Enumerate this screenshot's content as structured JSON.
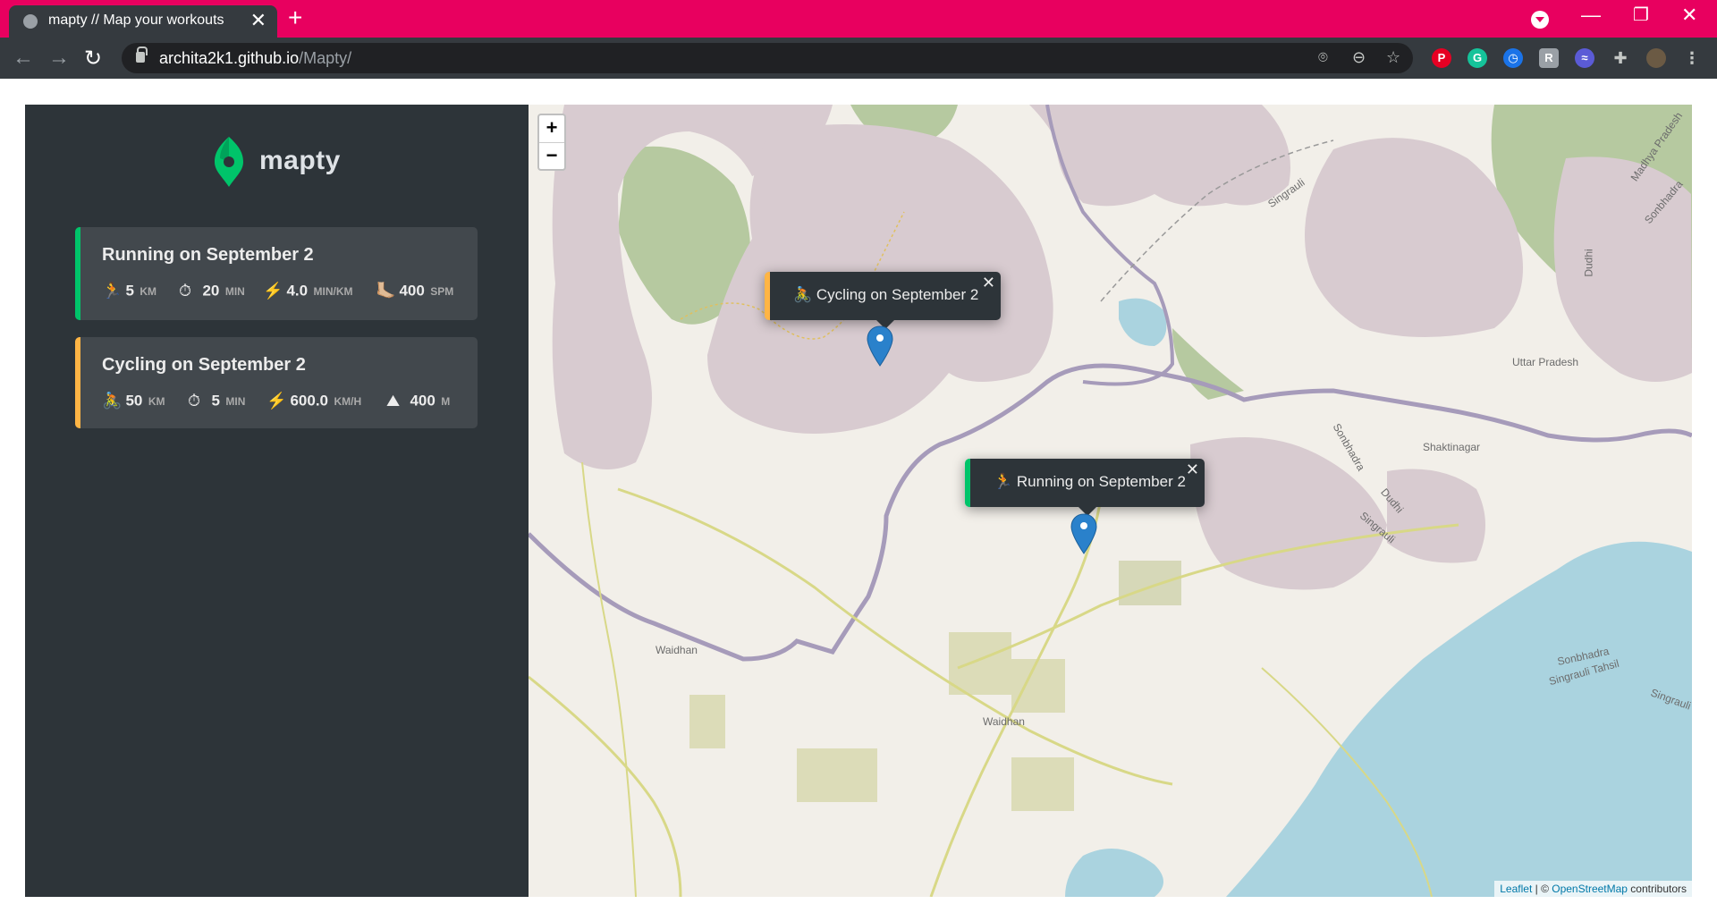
{
  "browser": {
    "tab_title": "mapty // Map your workouts",
    "tab_close": "✕",
    "new_tab": "+",
    "url_host": "archita2k1.github.io",
    "url_path": "/Mapty/",
    "back": "←",
    "forward": "→",
    "reload": "↻",
    "minimize": "—",
    "restore": "❐",
    "close": "✕",
    "extensions": [
      {
        "icon": "pinterest-icon",
        "letter": "P",
        "color": "#e60023"
      },
      {
        "icon": "grammarly-icon",
        "letter": "G",
        "color": "#15c39a"
      },
      {
        "icon": "clock-icon",
        "letter": "◷",
        "color": "#1a73e8"
      },
      {
        "icon": "r-extension-icon",
        "letter": "R",
        "color": "#9aa0a6"
      },
      {
        "icon": "wave-icon",
        "letter": "≈",
        "color": "#5b5bd6"
      }
    ],
    "accent_color": "#e8005f"
  },
  "app": {
    "logo_text": "mapty",
    "workouts": [
      {
        "type": "running",
        "title": "Running on September 2",
        "color": "#00c46a",
        "details": [
          {
            "icon": "🏃",
            "value": "5",
            "unit": "km"
          },
          {
            "icon": "⏱",
            "value": "20",
            "unit": "min"
          },
          {
            "icon": "⚡️",
            "value": "4.0",
            "unit": "min/km"
          },
          {
            "icon": "🦶🏼",
            "value": "400",
            "unit": "spm"
          }
        ]
      },
      {
        "type": "cycling",
        "title": "Cycling on September 2",
        "color": "#ffb545",
        "details": [
          {
            "icon": "🚴",
            "value": "50",
            "unit": "km"
          },
          {
            "icon": "⏱",
            "value": "5",
            "unit": "min"
          },
          {
            "icon": "⚡️",
            "value": "600.0",
            "unit": "km/h"
          },
          {
            "icon": "⛰",
            "value": "400",
            "unit": "m"
          }
        ]
      }
    ]
  },
  "map": {
    "zoom_in": "+",
    "zoom_out": "−",
    "popups": [
      {
        "type": "cycling",
        "text": "🚴 Cycling on September 2",
        "close": "✕"
      },
      {
        "type": "running",
        "text": "🏃 Running on September 2",
        "close": "✕"
      }
    ],
    "labels": [
      "Waidhan",
      "Waidhan",
      "Shaktinagar",
      "Uttar Pradesh",
      "Singrauli",
      "Sonbhadra",
      "Dudhi",
      "Singrauli",
      "Madhya Pradesh",
      "Sonbhadra",
      "Singrauli Tahsil",
      "Singrauli",
      "Sonbhadra",
      "Dudhi"
    ],
    "attribution_leaflet": "Leaflet",
    "attribution_sep": " | © ",
    "attribution_osm": "OpenStreetMap",
    "attribution_rest": " contributors"
  }
}
